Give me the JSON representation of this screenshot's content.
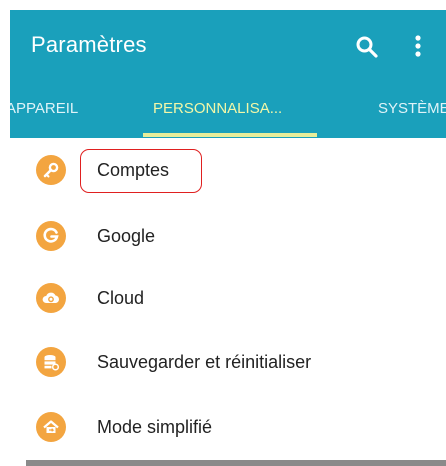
{
  "header": {
    "title": "Paramètres",
    "search_icon": "search-icon",
    "more_icon": "more-vert-icon"
  },
  "tabs": [
    {
      "label": "APPAREIL",
      "selected": false
    },
    {
      "label": "PERSONNALISA...",
      "selected": true
    },
    {
      "label": "SYSTÈME",
      "selected": false
    }
  ],
  "colors": {
    "accent": "#1aa0bb",
    "tab_selected": "#f2f7a8",
    "icon_bg": "#f3a540",
    "highlight": "#e02020"
  },
  "list": {
    "items": [
      {
        "label": "Comptes",
        "icon": "key-icon",
        "highlighted": true
      },
      {
        "label": "Google",
        "icon": "google-icon"
      },
      {
        "label": "Cloud",
        "icon": "cloud-icon"
      },
      {
        "label": "Sauvegarder et réinitialiser",
        "icon": "backup-icon"
      },
      {
        "label": "Mode simplifié",
        "icon": "home-icon"
      }
    ]
  }
}
